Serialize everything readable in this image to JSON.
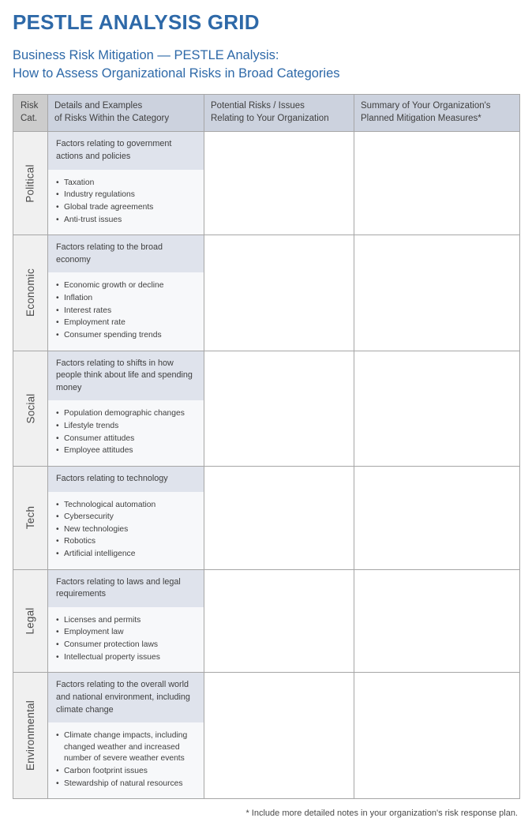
{
  "document": {
    "main_title": "PESTLE ANALYSIS GRID",
    "subtitle_line_1": "Business Risk Mitigation — PESTLE Analysis:",
    "subtitle_line_2": "How to Assess Organizational Risks in Broad Categories",
    "footnote": "* Include more detailed notes in your organization's risk response plan."
  },
  "colors": {
    "title_blue": "#2e69a8",
    "header_fill": "#ccd2de",
    "header_cat_fill": "#cccccc",
    "desc_band_fill": "#dfe3ec",
    "list_fill": "#f7f8fa",
    "cat_fill": "#f0f0f0",
    "border": "#a6a6a6"
  },
  "table": {
    "headers": {
      "category_line_1": "Risk",
      "category_line_2": "Cat.",
      "details_line_1": "Details and Examples",
      "details_line_2": "of Risks Within the Category",
      "risks_line_1": "Potential Risks / Issues",
      "risks_line_2": "Relating to Your Organization",
      "summary_line_1": "Summary of Your Organization's",
      "summary_line_2": "Planned Mitigation Measures*"
    },
    "rows": [
      {
        "category": "Political",
        "description": "Factors relating to government actions and policies",
        "items": [
          "Taxation",
          "Industry regulations",
          "Global trade agreements",
          "Anti-trust issues"
        ],
        "potential_risks": "",
        "mitigation_summary": ""
      },
      {
        "category": "Economic",
        "description": "Factors relating to the broad economy",
        "items": [
          "Economic growth or decline",
          "Inflation",
          "Interest rates",
          "Employment rate",
          "Consumer spending trends"
        ],
        "potential_risks": "",
        "mitigation_summary": ""
      },
      {
        "category": "Social",
        "description": "Factors relating to shifts in how people think about life and spending money",
        "items": [
          "Population demographic changes",
          "Lifestyle trends",
          "Consumer attitudes",
          "Employee attitudes"
        ],
        "potential_risks": "",
        "mitigation_summary": ""
      },
      {
        "category": "Tech",
        "description": "Factors relating to technology",
        "items": [
          "Technological automation",
          "Cybersecurity",
          "New technologies",
          "Robotics",
          "Artificial intelligence"
        ],
        "potential_risks": "",
        "mitigation_summary": ""
      },
      {
        "category": "Legal",
        "description": "Factors relating to laws and legal requirements",
        "items": [
          "Licenses and permits",
          "Employment law",
          "Consumer protection laws",
          "Intellectual property issues"
        ],
        "potential_risks": "",
        "mitigation_summary": ""
      },
      {
        "category": "Environmental",
        "description": "Factors relating to the overall world and national environment, including climate change",
        "items": [
          "Climate change impacts, including changed weather and increased number of severe weather events",
          "Carbon footprint issues",
          "Stewardship of natural resources"
        ],
        "potential_risks": "",
        "mitigation_summary": ""
      }
    ]
  }
}
